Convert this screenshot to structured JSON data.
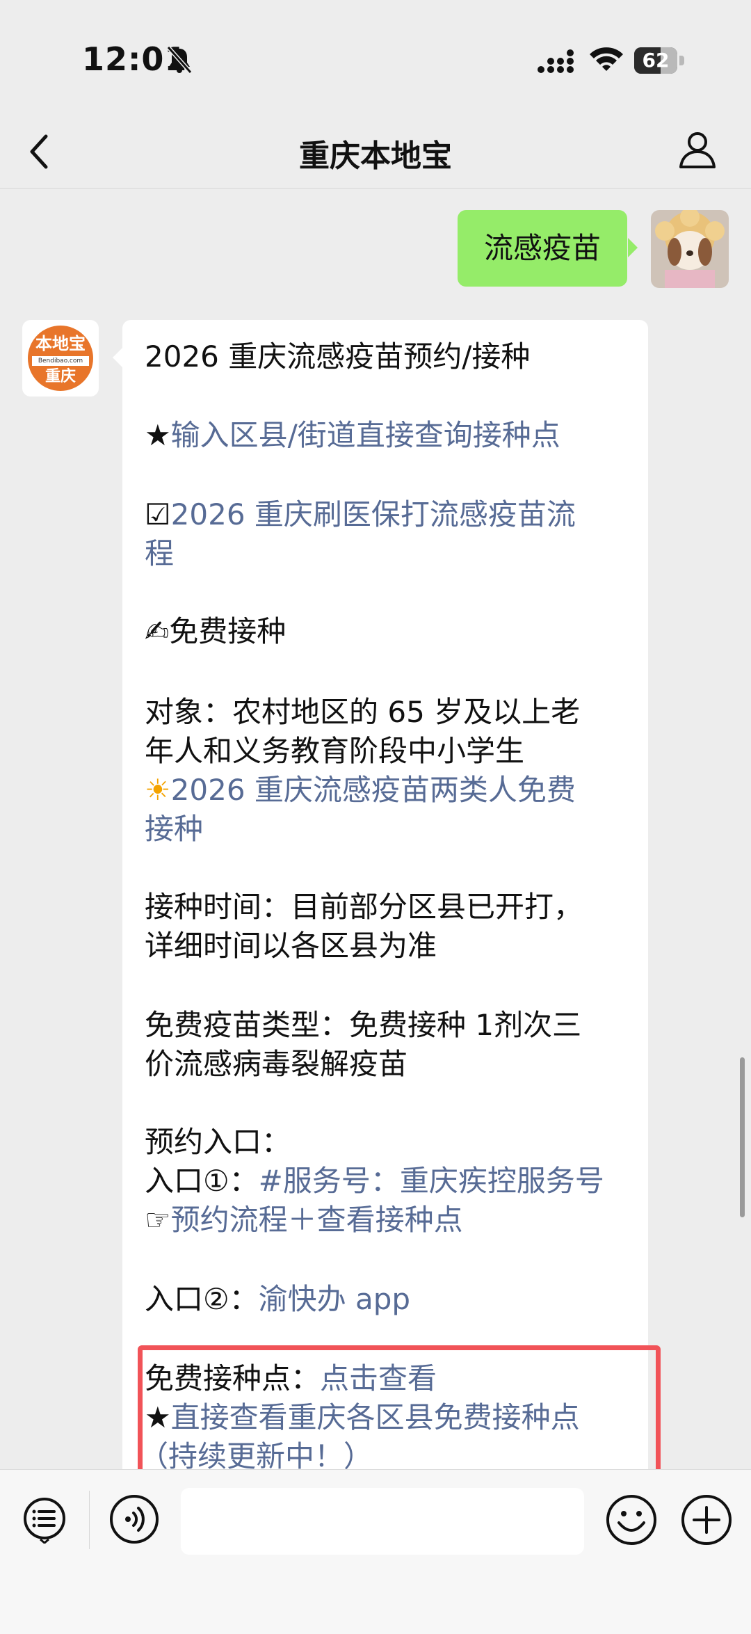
{
  "status_bar": {
    "time": "12:01",
    "battery": "62",
    "battery_level": 0.62,
    "icons": [
      "bell-slash-icon",
      "signal-icon",
      "wifi-icon",
      "battery-icon"
    ]
  },
  "nav": {
    "title": "重庆本地宝",
    "back_icon": "chevron-left-icon",
    "profile_icon": "person-icon"
  },
  "user_message": {
    "text": "流感疫苗",
    "bubble_color": "#95ec69"
  },
  "bot_avatar": {
    "top": "本地宝",
    "url": "Bendibao.com",
    "bottom": "重庆",
    "color": "#e8752a"
  },
  "bot_message": {
    "title": "2026 重庆流感疫苗预约/接种",
    "link1_prefix": "★",
    "link1": "输入区县/街道直接查询接种点",
    "link2_prefix": "☑",
    "link2_line1": "2026 重庆刷医保打流感疫苗流",
    "link2_line2": "程",
    "free_heading_prefix": "✍",
    "free_heading": "免费接种",
    "target_line1": "对象：农村地区的 65 岁及以上老",
    "target_line2": "年人和义务教育阶段中小学生",
    "link3_prefix": "☀",
    "link3_line1": "2026 重庆流感疫苗两类人免费",
    "link3_line2": "接种",
    "time_line1": "接种时间：目前部分区县已开打，",
    "time_line2": "详细时间以各区县为准",
    "type_line1": "免费疫苗类型：免费接种 1剂次三",
    "type_line2": "价流感病毒裂解疫苗",
    "entry_heading": "预约入口：",
    "entry1_label": "入口①：",
    "entry1_link": "#服务号：重庆疾控服务号",
    "entry1b_prefix": "☞",
    "entry1b_link": "预约流程＋查看接种点",
    "entry2_label": "入口②：",
    "entry2_link": "渝快办 app",
    "points_label": "免费接种点：",
    "points_link": "点击查看",
    "points2_prefix": "★",
    "points2_link": "直接查看重庆各区县免费接种点",
    "points3_link": "（持续更新中！）",
    "link_color": "#576b95",
    "highlight_color": "#f15358"
  },
  "input_bar": {
    "icons": [
      "menu-list-icon",
      "voice-icon",
      "emoji-icon",
      "plus-icon"
    ]
  }
}
